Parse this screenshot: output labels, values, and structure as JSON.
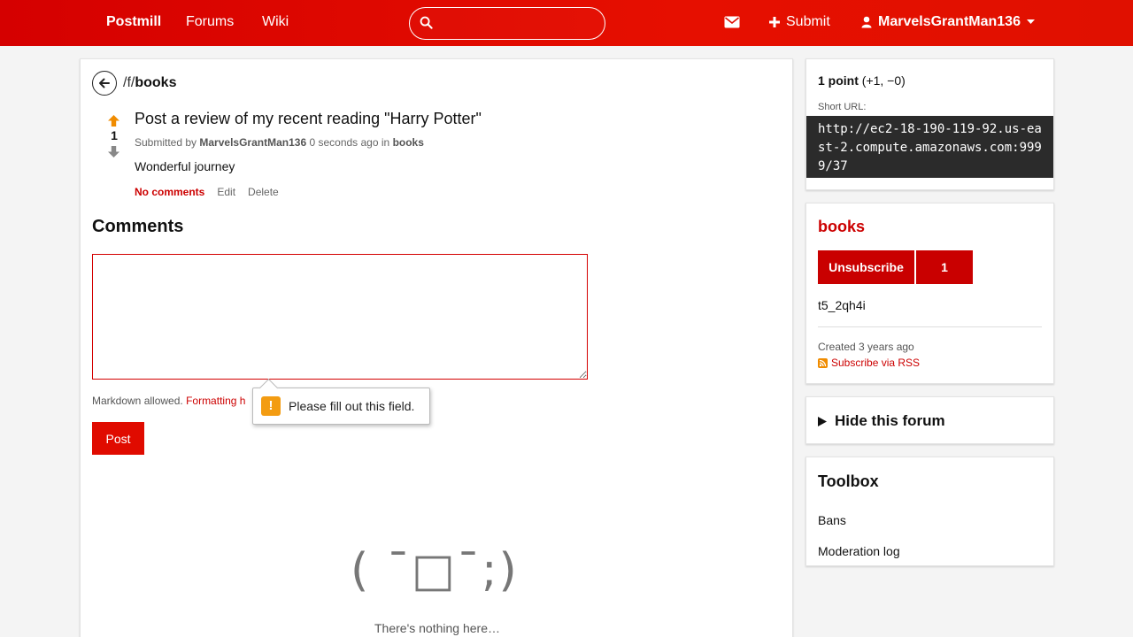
{
  "nav": {
    "brand": "Postmill",
    "forums": "Forums",
    "wiki": "Wiki",
    "search_value": "",
    "submit": "Submit",
    "user": "MarvelsGrantMan136",
    "icons": [
      "search-icon",
      "envelope-icon",
      "plus-icon",
      "user-icon",
      "caret-down-icon"
    ]
  },
  "breadcrumb": {
    "prefix": "/f/",
    "forum": "books"
  },
  "post": {
    "score": "1",
    "title": "Post a review of my recent reading \"Harry Potter\"",
    "meta_submitted_by": "Submitted by",
    "author": "MarvelsGrantMan136",
    "time": "0 seconds ago",
    "meta_in": "in",
    "forum": "books",
    "body": "Wonderful journey",
    "actions": {
      "comments": "No comments",
      "edit": "Edit",
      "delete": "Delete"
    }
  },
  "comments": {
    "heading": "Comments",
    "textarea_value": "",
    "markdown_note": "Markdown allowed.",
    "formatting_link": "Formatting h",
    "post_button": "Post",
    "validation_message": "Please fill out this field.",
    "empty_face": "( ¯□¯;)",
    "empty_text": "There's nothing here…"
  },
  "sidebar": {
    "score": {
      "points": "1 point",
      "breakdown": "(+1, −0)",
      "short_url_label": "Short URL:",
      "short_url": "http://ec2-18-190-119-92.us-east-2.compute.amazonaws.com:9999/37"
    },
    "forum": {
      "name": "books",
      "unsubscribe": "Unsubscribe",
      "subscriber_count": "1",
      "description": "t5_2qh4i",
      "created": "Created 3 years ago",
      "rss": "Subscribe via RSS"
    },
    "hide": {
      "label": "Hide this forum"
    },
    "toolbox": {
      "heading": "Toolbox",
      "bans": "Bans",
      "modlog": "Moderation log"
    }
  },
  "colors": {
    "brand_red": "#e00b00",
    "link_red": "#cc0000",
    "upvote_orange": "#f08c00",
    "warning_orange": "#f39c12"
  }
}
